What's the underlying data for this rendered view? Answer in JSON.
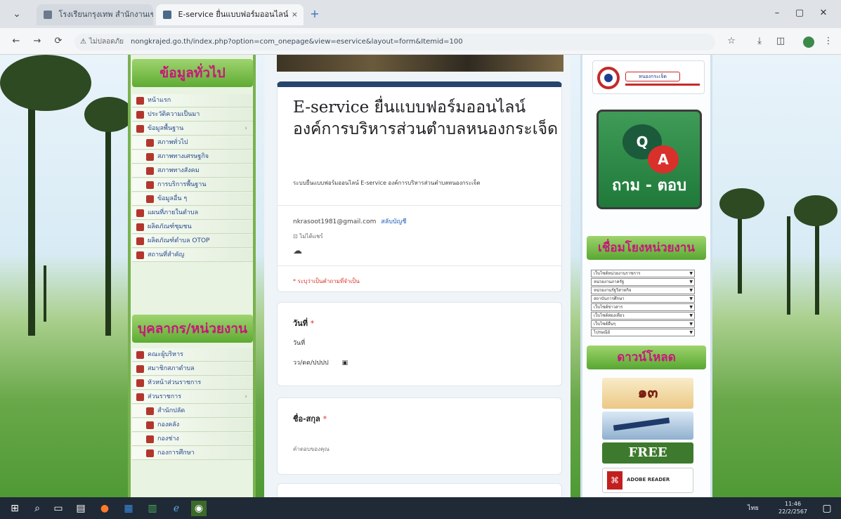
{
  "browser": {
    "tabs": [
      {
        "label": "โรงเรียนกรุงเทพ สำนักงานเขต...",
        "active": false
      },
      {
        "label": "E-service ยื่นแบบฟอร์มออนไลน์",
        "active": true
      }
    ],
    "address": {
      "security_label": "ไม่ปลอดภัย",
      "url": "nongkrajed.go.th/index.php?option=com_onepage&view=eservice&layout=form&Itemid=100"
    },
    "nav": {
      "back": "←",
      "forward": "→",
      "reload": "⟳",
      "close_tab": "×",
      "new_tab": "+"
    },
    "window": {
      "minimize": "–",
      "maximize": "▢",
      "close": "✕"
    },
    "toolbar_icons": [
      "star-icon",
      "download-icon",
      "sidebar-icon",
      "profile-icon",
      "menu-icon"
    ]
  },
  "left_sidebar": {
    "section1_title": "ข้อมูลทั่วไป",
    "section1_items": [
      {
        "label": "หน้าแรก",
        "sub": false
      },
      {
        "label": "ประวัติความเป็นมา",
        "sub": false
      },
      {
        "label": "ข้อมูลพื้นฐาน",
        "sub": false,
        "has_caret": true
      },
      {
        "label": "สภาพทั่วไป",
        "sub": true
      },
      {
        "label": "สภาพทางเศรษฐกิจ",
        "sub": true
      },
      {
        "label": "สภาพทางสังคม",
        "sub": true
      },
      {
        "label": "การบริการพื้นฐาน",
        "sub": true
      },
      {
        "label": "ข้อมูลอื่น ๆ",
        "sub": true
      },
      {
        "label": "แผนที่ภายในตำบล",
        "sub": false
      },
      {
        "label": "ผลิตภัณฑ์ชุมชน",
        "sub": false
      },
      {
        "label": "ผลิตภัณฑ์ตำบล OTOP",
        "sub": false
      },
      {
        "label": "สถานที่สำคัญ",
        "sub": false
      }
    ],
    "section2_title": "บุคลากร/หน่วยงาน",
    "section2_items": [
      {
        "label": "คณะผู้บริหาร",
        "sub": false
      },
      {
        "label": "สมาชิกสภาตำบล",
        "sub": false
      },
      {
        "label": "หัวหน้าส่วนราชการ",
        "sub": false
      },
      {
        "label": "ส่วนราชการ",
        "sub": false,
        "has_caret": true
      },
      {
        "label": "สำนักปลัด",
        "sub": true
      },
      {
        "label": "กองคลัง",
        "sub": true
      },
      {
        "label": "กองช่าง",
        "sub": true
      },
      {
        "label": "กองการศึกษา",
        "sub": true
      }
    ]
  },
  "form": {
    "title": "E-service ยื่นแบบฟอร์มออนไลน์ องค์การบริหารส่วนตำบลหนองกระเจ็ด",
    "description": "ระบบยื่นแบบฟอร์มออนไลน์ E-service องค์การบริหารส่วนตำบลหนองกระเจ็ด",
    "account_email": "nkrasoot1981@gmail.com",
    "switch_account": "สลับบัญชี",
    "not_shared": "ไม่ได้แชร์",
    "required_note": "* ระบุว่าเป็นคำถามที่จำเป็น",
    "questions": [
      {
        "title": "วันที่",
        "required_mark": "*",
        "sublabel": "วันที่",
        "placeholder": "วว/ดด/ปปปป"
      },
      {
        "title": "ชื่อ-สกุล",
        "required_mark": "*",
        "placeholder": "คำตอบของคุณ"
      }
    ]
  },
  "right_sidebar": {
    "logo_text": "หนองกระเจ็ด",
    "qa": {
      "q": "Q",
      "a": "A",
      "label": "ถาม - ตอบ"
    },
    "links_title": "เชื่อมโยงหน่วยงาน",
    "select_options": [
      "เว็บไซต์หน่วยงานราชการ",
      "หน่วยงานภาครัฐ",
      "หน่วยงานรัฐวิสาหกิจ",
      "สถาบันการศึกษา",
      "เว็บไซต์ข่าวสาร",
      "เว็บไซต์ท่องเที่ยว",
      "เว็บไซต์อื่นๆ",
      "ไปรษณีย์"
    ],
    "download_title": "ดาวน์โหลด",
    "adv1": "๑๓",
    "adv3": "FREE",
    "adv4": "ADOBE READER"
  },
  "taskbar": {
    "time": "11:46",
    "date": "22/2/2567",
    "lang": "ไทย"
  }
}
